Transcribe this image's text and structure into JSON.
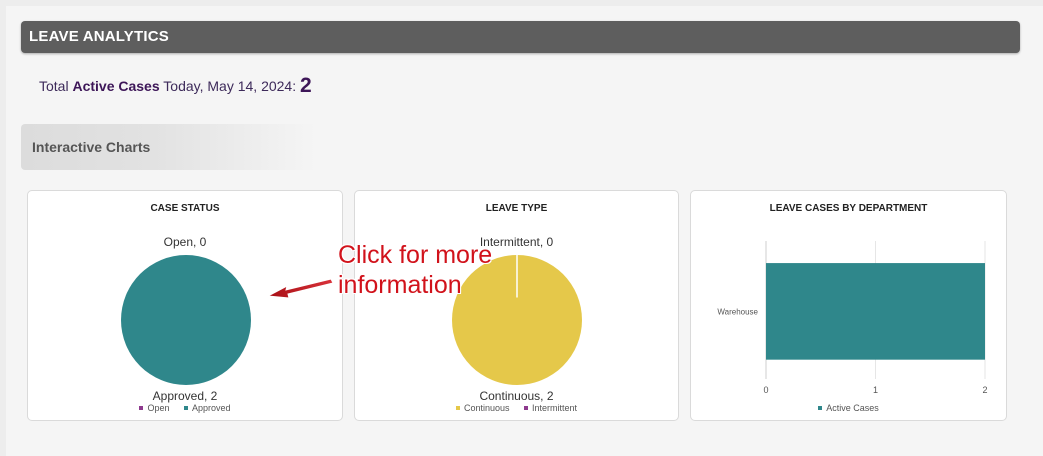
{
  "header": {
    "title": "LEAVE ANALYTICS"
  },
  "summary": {
    "prefix": "Total ",
    "bold": "Active Cases",
    "suffix": " Today, May 14, 2024: ",
    "count": "2"
  },
  "subheader": {
    "title": "Interactive Charts"
  },
  "annotation": {
    "line1": "Click for more",
    "line2": "information"
  },
  "colors": {
    "teal": "#2f878b",
    "yellow": "#e5c84a",
    "purple": "#8e3a8e"
  },
  "charts": {
    "case_status": {
      "title": "CASE STATUS",
      "top_label": "Open, 0",
      "bottom_label": "Approved, 2",
      "legend": [
        "Open",
        "Approved"
      ]
    },
    "leave_type": {
      "title": "LEAVE TYPE",
      "top_label": "Intermittent, 0",
      "bottom_label": "Continuous, 2",
      "legend": [
        "Continuous",
        "Intermittent"
      ]
    },
    "department": {
      "title": "LEAVE CASES BY DEPARTMENT",
      "category": "Warehouse",
      "ticks": [
        "0",
        "1",
        "2"
      ],
      "legend": [
        "Active Cases"
      ]
    }
  },
  "chart_data": [
    {
      "type": "pie",
      "title": "CASE STATUS",
      "categories": [
        "Open",
        "Approved"
      ],
      "values": [
        0,
        2
      ]
    },
    {
      "type": "pie",
      "title": "LEAVE TYPE",
      "categories": [
        "Continuous",
        "Intermittent"
      ],
      "values": [
        2,
        0
      ]
    },
    {
      "type": "bar",
      "title": "LEAVE CASES BY DEPARTMENT",
      "categories": [
        "Warehouse"
      ],
      "series": [
        {
          "name": "Active Cases",
          "values": [
            2
          ]
        }
      ],
      "xlim": [
        0,
        2
      ]
    }
  ]
}
